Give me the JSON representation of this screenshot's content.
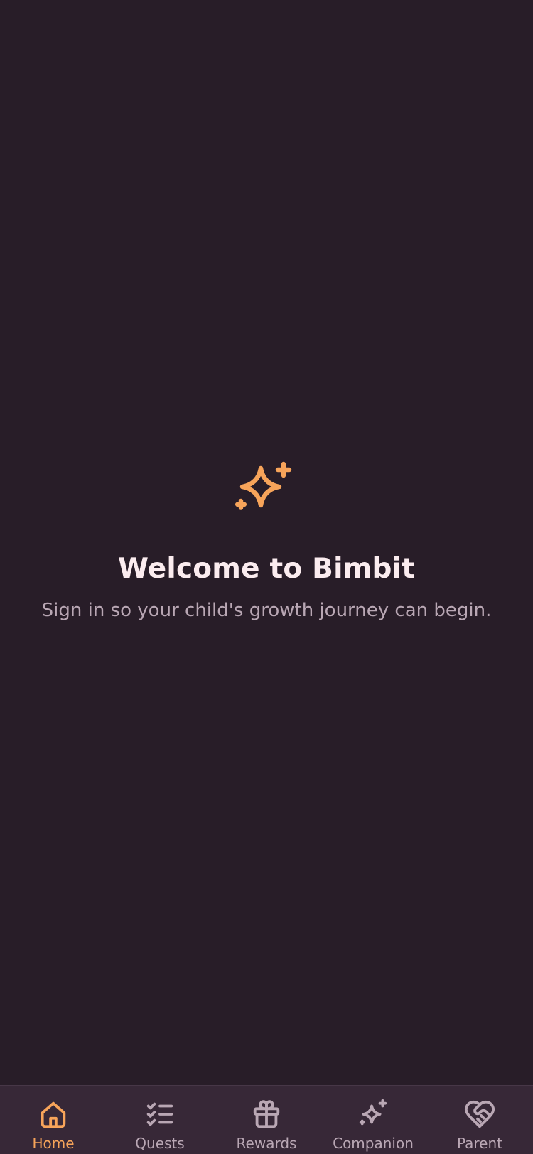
{
  "hero": {
    "icon": "sparkles-icon",
    "title": "Welcome to Bimbit",
    "subtitle": "Sign in so your child's growth journey can begin."
  },
  "colors": {
    "background": "#281d28",
    "accent": "#f7a45a",
    "muted": "#b9a7b4",
    "title": "#fbecef",
    "tabbar": "#372837"
  },
  "tabbar": {
    "active": "home",
    "items": [
      {
        "key": "home",
        "label": "Home",
        "icon": "home-icon"
      },
      {
        "key": "quests",
        "label": "Quests",
        "icon": "checklist-icon"
      },
      {
        "key": "rewards",
        "label": "Rewards",
        "icon": "gift-icon"
      },
      {
        "key": "companion",
        "label": "Companion",
        "icon": "sparkles-icon"
      },
      {
        "key": "parent",
        "label": "Parent",
        "icon": "heart-handshake-icon"
      }
    ]
  }
}
